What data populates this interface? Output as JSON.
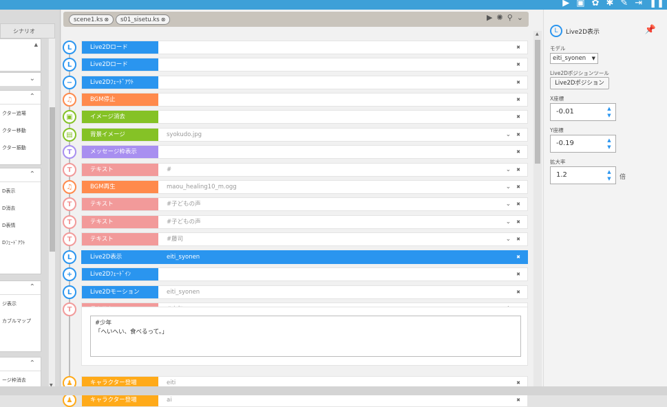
{
  "toolbar": {
    "icons": [
      "play-icon",
      "save-icon",
      "settings-gear-icon",
      "gear-icon",
      "wrench-icon",
      "export-icon",
      "pause-icon"
    ]
  },
  "left_panel": {
    "tab_label": "シナリオ",
    "groups": [
      {
        "items": []
      },
      {
        "items": []
      },
      {
        "items": [
          "クター追場",
          "クター移動",
          "クター振動"
        ]
      },
      {
        "items": [
          "D表示",
          "D消去",
          "D表情",
          "Dﾌｪｰﾄﾞｱｳﾄ"
        ]
      },
      {
        "items": [
          "ジ表示",
          "カブルマップ"
        ]
      },
      {
        "items": [
          "ージ枠消去"
        ]
      }
    ]
  },
  "file_tabs": [
    {
      "label": "scene1.ks"
    },
    {
      "label": "s01_sisetu.ks"
    }
  ],
  "rows": [
    {
      "label": "Live2Dロード",
      "value": "",
      "icon": "L",
      "color": "#2a95ef",
      "chev": false
    },
    {
      "label": "Live2Dロード",
      "value": "",
      "icon": "L",
      "color": "#2a95ef",
      "chev": false
    },
    {
      "label": "Live2Dﾌｪｰﾄﾞｱｳﾄ",
      "value": "",
      "icon": "−",
      "color": "#2a95ef",
      "chev": false
    },
    {
      "label": "BGM停止",
      "value": "",
      "icon": "♫",
      "color": "#ff8a4c",
      "chev": false
    },
    {
      "label": "イメージ消去",
      "value": "",
      "icon": "▣",
      "color": "#85c226",
      "chev": false
    },
    {
      "label": "背景イメージ",
      "value": "syokudo.jpg",
      "icon": "▤",
      "color": "#85c226",
      "chev": true
    },
    {
      "label": "メッセージ枠表示",
      "value": "",
      "icon": "T",
      "color": "#a88ff0",
      "chev": false
    },
    {
      "label": "テキスト",
      "value": "#",
      "icon": "T",
      "color": "#f29a9a",
      "chev": true
    },
    {
      "label": "BGM再生",
      "value": "maou_healing10_m.ogg",
      "icon": "♫",
      "color": "#ff8a4c",
      "chev": true
    },
    {
      "label": "テキスト",
      "value": "#子どもの声",
      "icon": "T",
      "color": "#f29a9a",
      "chev": true
    },
    {
      "label": "テキスト",
      "value": "#子どもの声",
      "icon": "T",
      "color": "#f29a9a",
      "chev": true
    },
    {
      "label": "テキスト",
      "value": "#藤司",
      "icon": "T",
      "color": "#f29a9a",
      "chev": true
    },
    {
      "label": "Live2D表示",
      "value": "eiti_syonen",
      "icon": "L",
      "color": "#2a95ef",
      "chev": false,
      "selected": true
    },
    {
      "label": "Live2Dﾌｪｰﾄﾞｲﾝ",
      "value": "",
      "icon": "+",
      "color": "#2a95ef",
      "chev": false
    },
    {
      "label": "Live2Dモーション",
      "value": "eiti_syonen",
      "icon": "L",
      "color": "#2a95ef",
      "chev": false
    },
    {
      "label": "テキスト",
      "value": "#少年",
      "icon": "T",
      "color": "#f29a9a",
      "chev": false,
      "expanded": true
    },
    {
      "label": "キャラクター登場",
      "value": "eiti",
      "icon": "♟",
      "color": "#ffaa19",
      "chev": false
    },
    {
      "label": "キャラクター登場",
      "value": "ai",
      "icon": "♟",
      "color": "#ffaa19",
      "chev": false
    }
  ],
  "expanded_text": "#少年\n「へいへい、食べるって。」",
  "right_panel": {
    "title": "Live2D表示",
    "model_label": "モデル",
    "model_value": "eiti_syonen",
    "position_tool_label": "Live2Dポジションツール",
    "position_button": "Live2Dポジション",
    "x_label": "X座標",
    "x_value": "-0.01",
    "y_label": "Y座標",
    "y_value": "-0.19",
    "scale_label": "拡大率",
    "scale_value": "1.2",
    "scale_unit": "倍"
  }
}
